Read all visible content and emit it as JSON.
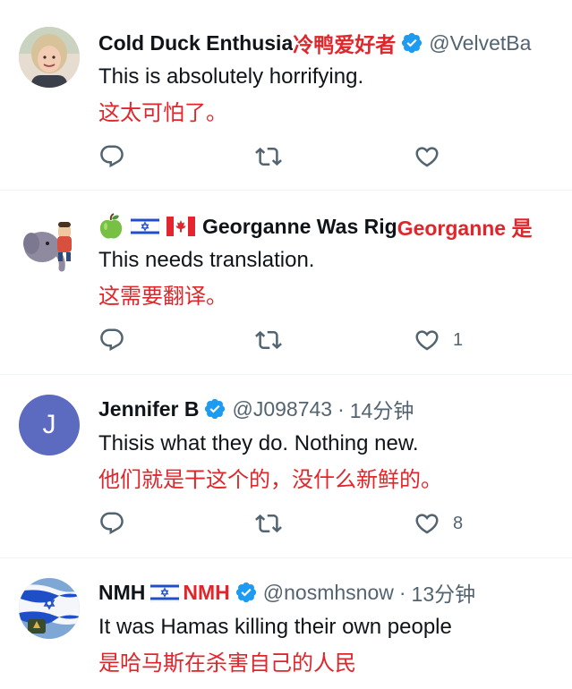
{
  "tweets": [
    {
      "display_name": "Cold Duck Enthusia",
      "display_name_translation": "冷鸭爱好者",
      "handle": "@VelvetBa",
      "time": "",
      "text": "This is absolutely horrifying.",
      "translation": "这太可怕了。",
      "likes": "",
      "verified": true
    },
    {
      "display_name": "Georganne Was Rig",
      "display_name_translation": "Georganne 是",
      "handle": "",
      "time": "",
      "text": "This needs translation.",
      "translation": "这需要翻译。",
      "likes": "1",
      "verified": false
    },
    {
      "display_name": "Jennifer B",
      "display_name_translation": "",
      "handle": "@J098743",
      "separator": "·",
      "time": "14分钟",
      "text": "Thisis what they do. Nothing new.",
      "translation": "他们就是干这个的，没什么新鲜的。",
      "likes": "8",
      "verified": true,
      "avatar_letter": "J"
    },
    {
      "display_name": "NMH",
      "display_name_translation": "NMH",
      "handle": "@nosmhsnow",
      "separator": "·",
      "time": "13分钟",
      "text": "It was Hamas killing their own people",
      "translation": "是哈马斯在杀害自己的人民",
      "likes": "",
      "verified": true
    }
  ],
  "colors": {
    "translation": "#e0262b",
    "verified_blue": "#1d9bf0",
    "secondary_text": "#536471",
    "divider": "#eff3f4",
    "avatar_purple": "#5c6bc0"
  },
  "icons": {
    "reply": "reply-icon",
    "retweet": "retweet-icon",
    "like": "heart-icon",
    "verified": "verified-badge-icon"
  }
}
